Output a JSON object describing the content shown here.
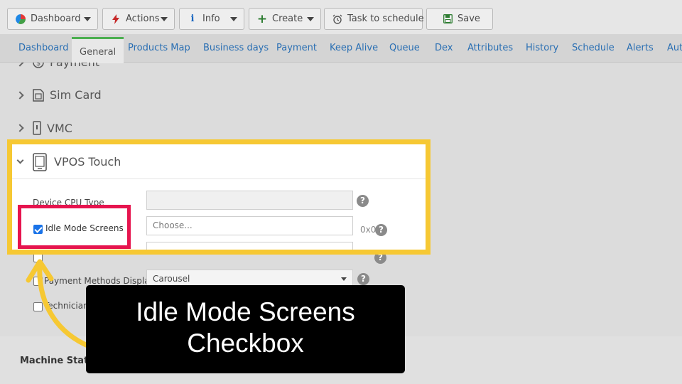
{
  "toolbar": {
    "dashboard": "Dashboard",
    "actions": "Actions",
    "info": "Info",
    "create": "Create",
    "task": "Task to schedule",
    "save": "Save"
  },
  "tabs": [
    "Dashboard",
    "General",
    "Products Map",
    "Business days",
    "Payment",
    "Keep Alive",
    "Queue",
    "Dex",
    "Attributes",
    "History",
    "Schedule",
    "Alerts",
    "Aut"
  ],
  "active_tab": "General",
  "sections": {
    "payment": "Payment",
    "sim_card": "Sim Card",
    "vmc": "VMC",
    "vpos": "VPOS Touch"
  },
  "fields": {
    "device_cpu_type": "Device CPU Type",
    "idle_mode_screens": "Idle Mode Screens",
    "idle_placeholder": "Choose...",
    "idle_size": "0x0",
    "payment_methods_display": "Payment Methods Display",
    "payment_methods_value": "Carousel",
    "technician": "Technician",
    "machine_status": "Machine Statu"
  },
  "annotation": {
    "line1": "Idle Mode Screens",
    "line2": "Checkbox"
  },
  "colors": {
    "highlight_yellow": "#f6c833",
    "highlight_red": "#e6144e",
    "tab_active_accent": "#4caf50",
    "link_blue": "#2a6fb3"
  }
}
